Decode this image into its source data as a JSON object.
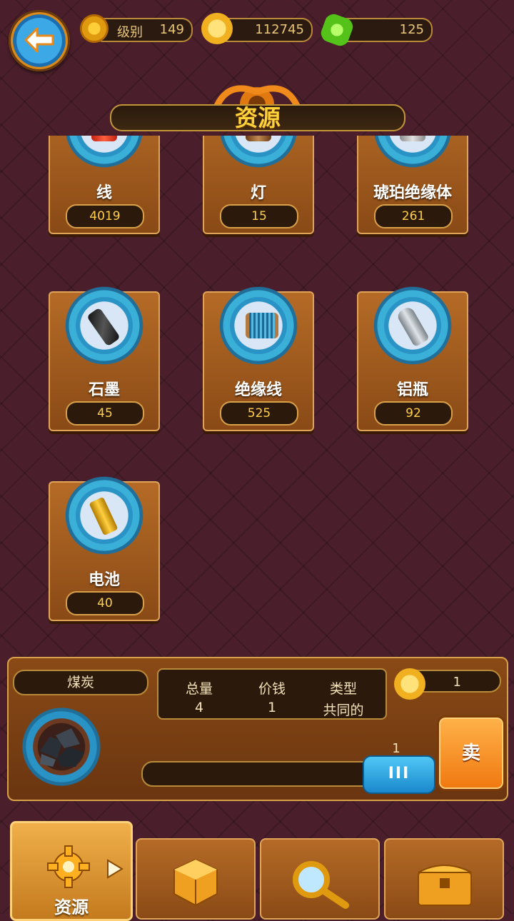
{
  "top_bar": {
    "level_label": "级别",
    "level_value": "149",
    "coins": "112745",
    "gems": "125"
  },
  "title": "资源",
  "resources": [
    {
      "name": "线",
      "count": "4019"
    },
    {
      "name": "灯",
      "count": "15"
    },
    {
      "name": "琥珀绝缘体",
      "count": "261"
    },
    {
      "name": "石墨",
      "count": "45"
    },
    {
      "name": "绝缘线",
      "count": "525"
    },
    {
      "name": "铝瓶",
      "count": "92"
    },
    {
      "name": "电池",
      "count": "40"
    }
  ],
  "detail": {
    "name": "煤炭",
    "headers": [
      "总量",
      "价钱",
      "类型"
    ],
    "values": [
      "4",
      "1",
      "共同的"
    ],
    "sell_price": "1",
    "slider_value": "1",
    "slider_handle_label": "III",
    "sell_label": "卖"
  },
  "tabs": {
    "active_label": "资源"
  },
  "colors": {
    "accent_gold": "#ffd23a",
    "panel_brown": "#8a4a16",
    "slider_blue": "#1a88cc",
    "sell_orange": "#f07810"
  }
}
